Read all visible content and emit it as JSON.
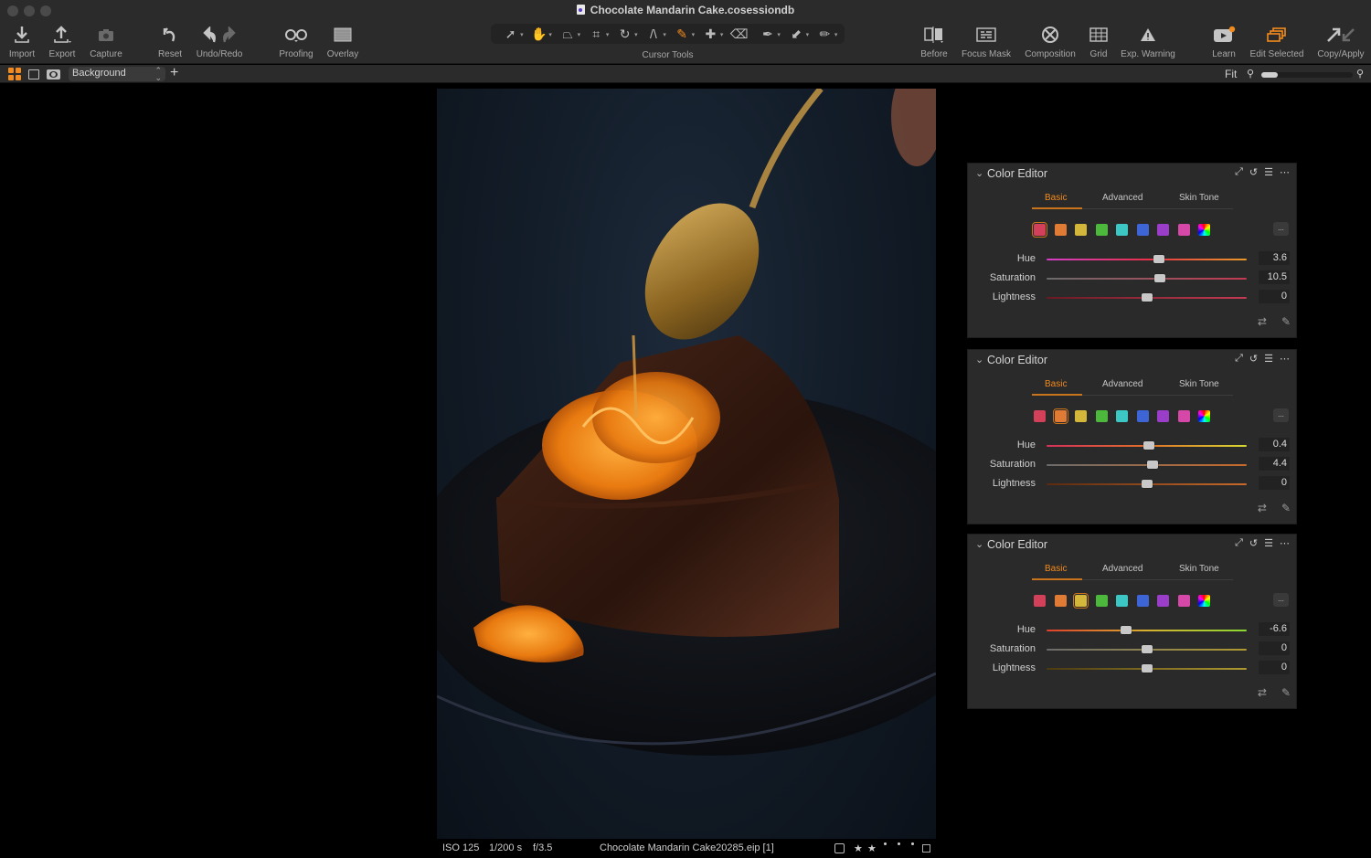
{
  "window": {
    "title": "Chocolate Mandarin Cake.cosessiondb"
  },
  "toolbar": {
    "left": [
      {
        "id": "import",
        "label": "Import",
        "icon": "import-icon"
      },
      {
        "id": "export",
        "label": "Export",
        "icon": "export-icon"
      },
      {
        "id": "capture",
        "label": "Capture",
        "icon": "camera-icon"
      },
      {
        "id": "reset",
        "label": "Reset",
        "icon": "reset-icon"
      },
      {
        "id": "undo-redo",
        "label": "Undo/Redo",
        "icon": "undo-redo-icon"
      },
      {
        "id": "proofing",
        "label": "Proofing",
        "icon": "glasses-icon"
      },
      {
        "id": "overlay",
        "label": "Overlay",
        "icon": "overlay-icon"
      }
    ],
    "cursor_tools_label": "Cursor Tools",
    "cursor_tools": [
      {
        "name": "select",
        "glyph": "➚"
      },
      {
        "name": "pan",
        "glyph": "✋"
      },
      {
        "name": "keystone",
        "glyph": "⏢"
      },
      {
        "name": "crop",
        "glyph": "⌗"
      },
      {
        "name": "rotate",
        "glyph": "↻"
      },
      {
        "name": "straighten",
        "glyph": "/\\"
      },
      {
        "name": "brush",
        "glyph": "✎",
        "active": true
      },
      {
        "name": "heal",
        "glyph": "✚"
      },
      {
        "name": "erase",
        "glyph": "⌫"
      },
      {
        "name": "color-picker",
        "glyph": "✒"
      },
      {
        "name": "gradient",
        "glyph": "⬋"
      },
      {
        "name": "annotate",
        "glyph": "✏"
      }
    ],
    "right": [
      {
        "id": "before",
        "label": "Before",
        "icon": "before-after-icon"
      },
      {
        "id": "focus-mask",
        "label": "Focus Mask",
        "icon": "focus-mask-icon"
      },
      {
        "id": "composition",
        "label": "Composition",
        "icon": "composition-icon"
      },
      {
        "id": "grid",
        "label": "Grid",
        "icon": "grid-icon"
      },
      {
        "id": "exp-warning",
        "label": "Exp. Warning",
        "icon": "warning-icon"
      },
      {
        "id": "learn",
        "label": "Learn",
        "icon": "play-icon"
      },
      {
        "id": "edit-selected",
        "label": "Edit Selected",
        "icon": "edit-selected-icon"
      },
      {
        "id": "copy-apply",
        "label": "Copy/Apply",
        "icon": "copy-apply-icon"
      }
    ]
  },
  "subbar": {
    "layer": "Background",
    "fit_label": "Fit",
    "zoom_fraction": 0.18
  },
  "status": {
    "iso": "ISO 125",
    "shutter": "1/200 s",
    "aperture": "f/3.5",
    "filename": "Chocolate Mandarin Cake20285.eip [1]",
    "stars": 2,
    "max_stars": 5
  },
  "colors": {
    "accent": "#f28a1d",
    "swatches": [
      "#d2405a",
      "#e07b35",
      "#d4b63a",
      "#4cb83c",
      "#3cc6c4",
      "#3e65d6",
      "#9a3dc8",
      "#d548a8"
    ]
  },
  "panels": [
    {
      "title": "Color Editor",
      "tabs": [
        "Basic",
        "Advanced",
        "Skin Tone"
      ],
      "active_tab": 0,
      "selected_swatch": 0,
      "sliders": [
        {
          "label": "Hue",
          "value": "3.6",
          "pos": 0.56,
          "gradient": "linear-gradient(90deg,#d43ec8,#e8304a 50%,#e89a28)"
        },
        {
          "label": "Saturation",
          "value": "10.5",
          "pos": 0.565,
          "gradient": "linear-gradient(90deg,#6b6b6b,#c43a52)"
        },
        {
          "label": "Lightness",
          "value": "0",
          "pos": 0.5,
          "gradient": "linear-gradient(90deg,#6a1a24,#c43a52)"
        }
      ]
    },
    {
      "title": "Color Editor",
      "tabs": [
        "Basic",
        "Advanced",
        "Skin Tone"
      ],
      "active_tab": 0,
      "selected_swatch": 1,
      "sliders": [
        {
          "label": "Hue",
          "value": "0.4",
          "pos": 0.51,
          "gradient": "linear-gradient(90deg,#d8305a,#e0702a 50%,#d8d830)"
        },
        {
          "label": "Saturation",
          "value": "4.4",
          "pos": 0.53,
          "gradient": "linear-gradient(90deg,#6b6b6b,#c86a2a)"
        },
        {
          "label": "Lightness",
          "value": "0",
          "pos": 0.5,
          "gradient": "linear-gradient(90deg,#5a2a10,#c86a2a)"
        }
      ]
    },
    {
      "title": "Color Editor",
      "tabs": [
        "Basic",
        "Advanced",
        "Skin Tone"
      ],
      "active_tab": 0,
      "selected_swatch": 2,
      "sliders": [
        {
          "label": "Hue",
          "value": "-6.6",
          "pos": 0.395,
          "gradient": "linear-gradient(90deg,#e0402a,#d8b030 50%,#8ad830)"
        },
        {
          "label": "Saturation",
          "value": "0",
          "pos": 0.5,
          "gradient": "linear-gradient(90deg,#6b6b6b,#b09a30)"
        },
        {
          "label": "Lightness",
          "value": "0",
          "pos": 0.5,
          "gradient": "linear-gradient(90deg,#4a3a10,#b09a30)"
        }
      ]
    }
  ]
}
